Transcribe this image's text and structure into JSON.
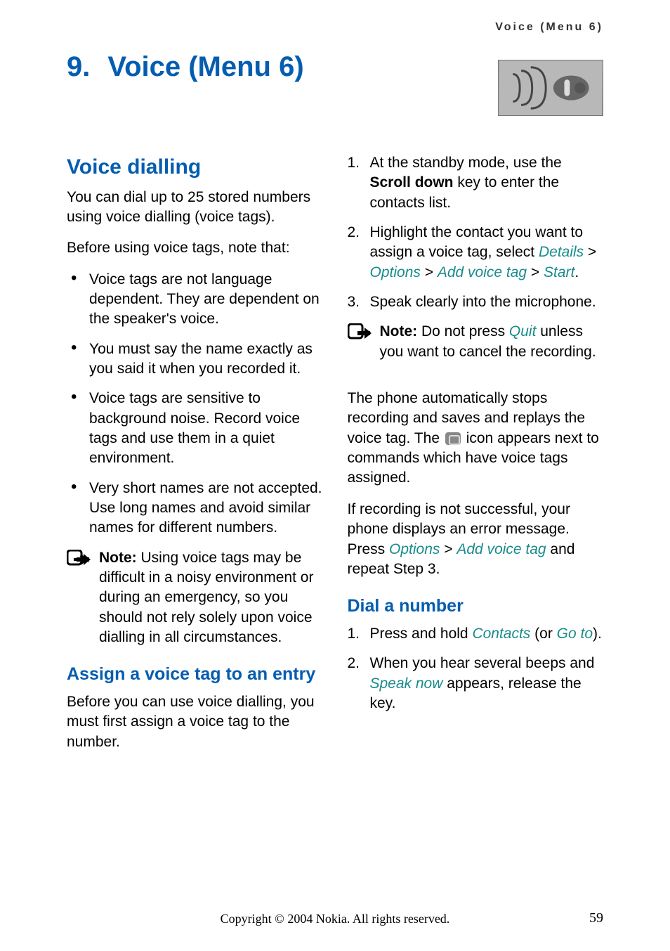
{
  "header": {
    "running": "Voice (Menu 6)"
  },
  "chapter": {
    "number": "9.",
    "title": "Voice (Menu 6)"
  },
  "left": {
    "h2": "Voice dialling",
    "intro": "You can dial up to 25 stored numbers using voice dialling (voice tags).",
    "before": "Before using voice tags, note that:",
    "bullets": [
      "Voice tags are not language dependent. They are dependent on the speaker's voice.",
      "You must say the name exactly as you said it when you recorded it.",
      "Voice tags are sensitive to background noise. Record voice tags and use them in a quiet environment.",
      "Very short names are not accepted. Use long names and avoid similar names for different numbers."
    ],
    "note_label": "Note:",
    "note_text": " Using voice tags may be difficult in a noisy environment or during an emergency, so you should not rely solely upon voice dialling in all circumstances.",
    "h3": "Assign a voice tag to an entry",
    "assign_p": "Before you can use voice dialling, you must first assign a voice tag to the number."
  },
  "right": {
    "step1_pre": "At the standby mode, use the ",
    "step1_bold": "Scroll down",
    "step1_post": " key to enter the contacts list.",
    "step2_pre": "Highlight the contact you want to assign a voice tag, select ",
    "step2_details": "Details",
    "step2_gt1": " > ",
    "step2_options": "Options",
    "step2_gt2": " > ",
    "step2_add": "Add voice tag",
    "step2_gt3": " > ",
    "step2_start": "Start",
    "step2_end": ".",
    "step3": "Speak clearly into the microphone.",
    "note_label": "Note:",
    "note_pre": " Do not press ",
    "note_quit": "Quit",
    "note_post": " unless you want to cancel the recording.",
    "auto_pre": "The phone automatically stops recording and saves and replays the voice tag. The ",
    "auto_post": " icon appears next to commands which have voice tags assigned.",
    "fail_pre": "If recording is not successful, your phone displays an error message. Press ",
    "fail_options": "Options",
    "fail_gt": " > ",
    "fail_add": "Add voice tag",
    "fail_post": " and repeat Step 3.",
    "h3": "Dial a number",
    "d1_pre": "Press and hold ",
    "d1_contacts": "Contacts",
    "d1_mid": " (or ",
    "d1_goto": "Go to",
    "d1_end": ").",
    "d2_pre": "When you hear several beeps and ",
    "d2_speak": "Speak now",
    "d2_post": " appears, release the key."
  },
  "footer": {
    "copyright": "Copyright © 2004 Nokia. All rights reserved.",
    "page": "59"
  }
}
